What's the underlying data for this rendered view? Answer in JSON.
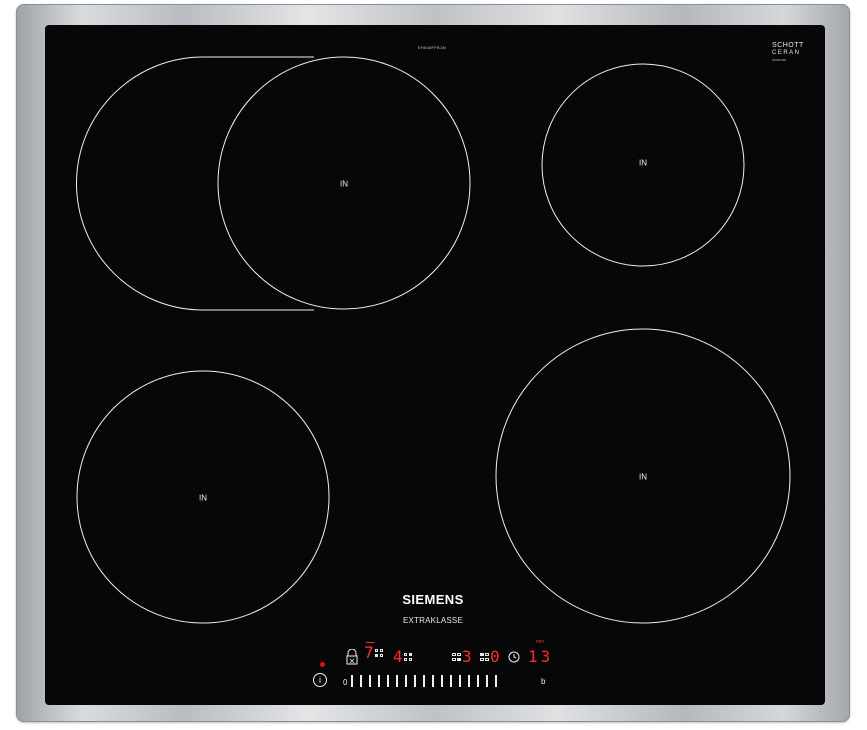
{
  "hob": {
    "model_number": "EH645FFB1M",
    "brand": "SIEMENS",
    "series": "EXTRAKLASSE",
    "glass_brand_line1": "SCHOTT",
    "glass_brand_line2": "CERAN",
    "glass_serial": "0025/0456"
  },
  "zones": [
    {
      "id": "rear-left",
      "label": "IN"
    },
    {
      "id": "rear-right",
      "label": "IN"
    },
    {
      "id": "front-left",
      "label": "IN"
    },
    {
      "id": "front-right",
      "label": "IN"
    }
  ],
  "control_panel": {
    "zone1_level": "7",
    "zone2_level": "4",
    "zone3_level": "3",
    "zone4_level": "0",
    "timer_value": "13",
    "timer_unit": "min",
    "slider_start": "0",
    "slider_end": "b",
    "power_symbol": "i",
    "tick_count": 17
  },
  "colors": {
    "glass": "#070707",
    "display_red": "#ff2b2b",
    "frame": "#c7cacd"
  }
}
